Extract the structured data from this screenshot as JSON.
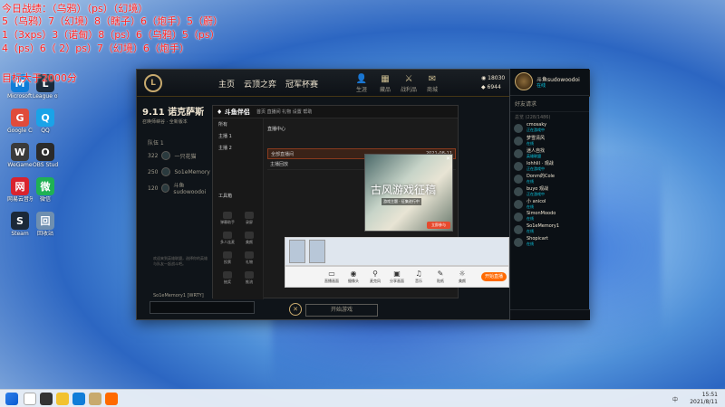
{
  "overlay": {
    "lines": [
      "今日战绩：（乌鸦）（ps）（幻境）",
      "5（乌鸦）7（幻境）8（瞎子）6（炮手）5（蔚）",
      "1（3xps）3（诺甸）8（ps）6（乌鸦）5（ps）",
      "4（ps）6（ 2）ps）7（幻境）6（炮手）",
      "目标大于2000分"
    ]
  },
  "desktop": {
    "icons": [
      {
        "label": "Microsoft Edge",
        "color": "#0f7dd8"
      },
      {
        "label": "League of Legends",
        "color": "#1b2a3b"
      },
      {
        "label": "Google Chrome",
        "color": "#e04b3a"
      },
      {
        "label": "QQ",
        "color": "#1aa3e8"
      },
      {
        "label": "WeGame",
        "color": "#3a3a3a"
      },
      {
        "label": "OBS Studio",
        "color": "#2b2b2b"
      },
      {
        "label": "网易云音乐",
        "color": "#d9232e"
      },
      {
        "label": "微信",
        "color": "#1fb154"
      },
      {
        "label": "Steam",
        "color": "#1b2838"
      },
      {
        "label": "回收站",
        "color": "#6f8fb0"
      }
    ]
  },
  "client": {
    "logo": "L",
    "nav": {
      "home": "主页",
      "tft": "云顶之弈",
      "cup": "冠军杯赛"
    },
    "top_icons": [
      {
        "glyph": "👤",
        "label": "生涯"
      },
      {
        "glyph": "▦",
        "label": "藏品"
      },
      {
        "glyph": "⚔",
        "label": "战利品"
      },
      {
        "glyph": "✉",
        "label": "商城"
      }
    ],
    "currency": {
      "rp": "18030",
      "be": "6944"
    },
    "patch_title": "9.11 诺克萨斯",
    "patch_sub": "召唤师峡谷 · 全新版本",
    "section": "队伍 1",
    "players": [
      {
        "rank": "322",
        "name": "一只花猫"
      },
      {
        "rank": "250",
        "name": "So1eMemory"
      },
      {
        "rank": "120",
        "name": "斗鱼sudowoodoi"
      }
    ],
    "desc_text": "欢迎来到英雄联盟，选择你的英雄与队友一起战斗吧。",
    "desc_strong": "So1eMemory1 [WRTY]",
    "play_label": "开始游戏"
  },
  "friends": {
    "profile_name": "斗鱼sudowoodoi",
    "profile_status": "在线",
    "title": "好友请求",
    "group": "总览 (228/1486)",
    "items": [
      {
        "name": "cmosaky",
        "status": "正在游戏中"
      },
      {
        "name": "梦雪清风",
        "status": "在线"
      },
      {
        "name": "迷人自找",
        "status": "英雄联盟"
      },
      {
        "name": "lohhlil · 观战",
        "status": "正在游戏中"
      },
      {
        "name": "Donm的Cole",
        "status": "在线"
      },
      {
        "name": "buyo 观战",
        "status": "正在游戏中"
      },
      {
        "name": "小 anicol",
        "status": "在线"
      },
      {
        "name": "SimonMoodo",
        "status": "在线"
      },
      {
        "name": "So1eMemory1",
        "status": "在线"
      },
      {
        "name": "Shopicart",
        "status": "在线"
      }
    ]
  },
  "wegame": {
    "logo": "♦ 斗鱼伴侣",
    "tabs": "首页  直播间  礼物  设置  帮助",
    "side_items": [
      "所有",
      "主播 1",
      "主播 2",
      "工具箱"
    ],
    "grid": [
      "弹幕助手",
      "录屏",
      "多人连麦",
      "美颜",
      "投票",
      "礼物",
      "抽奖",
      "推流"
    ],
    "head": "直播中心",
    "rows": [
      {
        "label": "全部直播间",
        "value": "2021-08-11",
        "active": true
      },
      {
        "label": "主播回放",
        "value": "2021-08-10",
        "active": false
      }
    ]
  },
  "ad": {
    "title": "古风游戏征稿",
    "subtitle": "游戏主题 · 征集进行中",
    "button": "立即参与"
  },
  "stream_bar": {
    "buttons": [
      {
        "glyph": "▭",
        "label": "直播画面"
      },
      {
        "glyph": "◉",
        "label": "摄像头"
      },
      {
        "glyph": "⚲",
        "label": "麦克风"
      },
      {
        "glyph": "▣",
        "label": "分享画面"
      },
      {
        "glyph": "♫",
        "label": "音乐"
      },
      {
        "glyph": "✎",
        "label": "贴纸"
      },
      {
        "glyph": "☼",
        "label": "美颜"
      }
    ],
    "live_label": "开始直播"
  },
  "taskbar": {
    "time": "15:51",
    "date": "2021/8/11",
    "sys": "中"
  }
}
